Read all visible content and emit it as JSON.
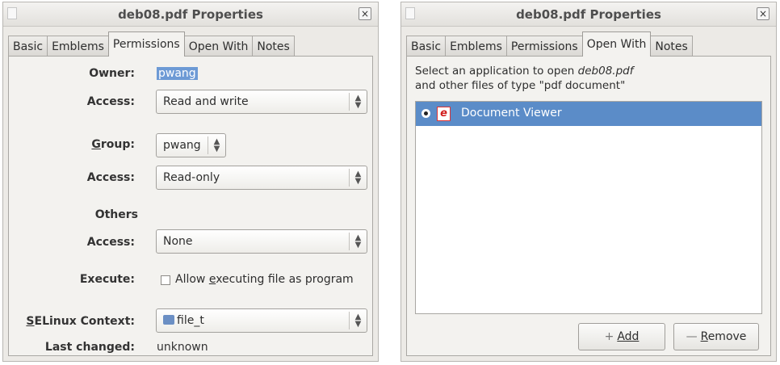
{
  "left_window": {
    "title": "deb08.pdf Properties",
    "close_glyph": "×",
    "tabs": [
      "Basic",
      "Emblems",
      "Permissions",
      "Open With",
      "Notes"
    ],
    "active_tab": "Permissions",
    "owner": {
      "label": "Owner:",
      "value": "pwang"
    },
    "owner_access": {
      "label": "Access:",
      "value": "Read and write"
    },
    "group": {
      "label": "Group:",
      "value": "pwang"
    },
    "group_access": {
      "label": "Access:",
      "value": "Read-only"
    },
    "others": {
      "heading": "Others",
      "access_label": "Access:",
      "access_value": "None"
    },
    "execute": {
      "label": "Execute:",
      "checkbox_label": "Allow executing file as program",
      "checked": false
    },
    "selinux": {
      "label": "SELinux Context:",
      "value": "file_t"
    },
    "last_changed": {
      "label": "Last changed:",
      "value": "unknown"
    }
  },
  "right_window": {
    "title": "deb08.pdf Properties",
    "close_glyph": "×",
    "tabs": [
      "Basic",
      "Emblems",
      "Permissions",
      "Open With",
      "Notes"
    ],
    "active_tab": "Open With",
    "description_line1_prefix": "Select an application to open ",
    "description_filename": "deb08.pdf",
    "description_line2": "and other files of type \"pdf document\"",
    "applications": [
      {
        "name": "Document Viewer",
        "selected": true,
        "icon": "document-viewer-icon"
      }
    ],
    "add_button": "Add",
    "remove_button": "Remove"
  },
  "colors": {
    "selection": "#5b8cc8",
    "window_bg": "#eceae6"
  }
}
